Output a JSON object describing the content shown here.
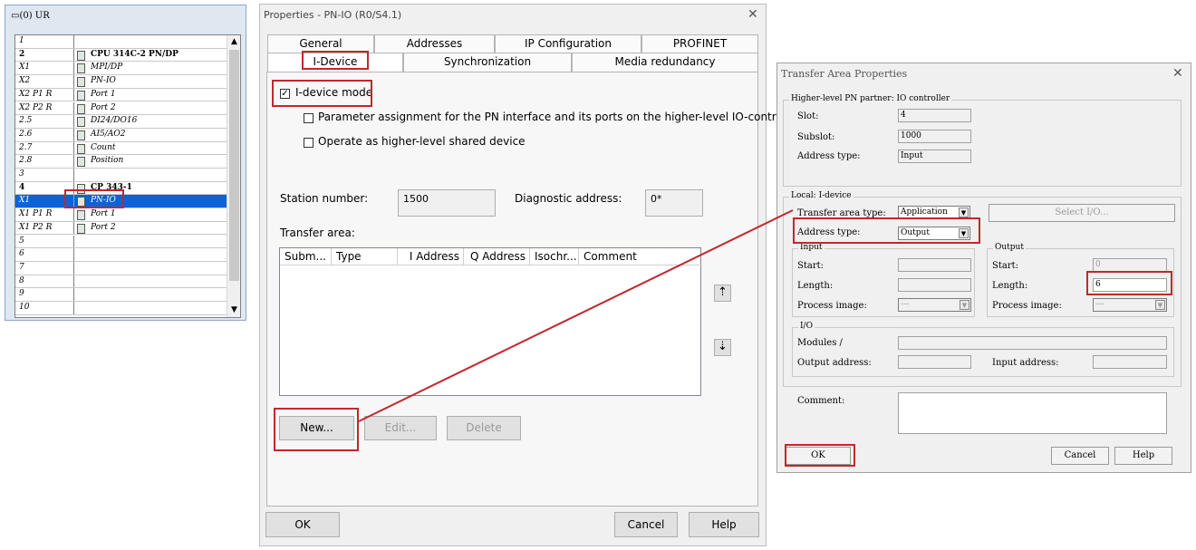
{
  "rack": {
    "title": "(0) UR",
    "rows": [
      {
        "slot": "1",
        "module": "",
        "bold": false,
        "icon": false
      },
      {
        "slot": "2",
        "module": "CPU 314C-2 PN/DP",
        "bold": true,
        "icon": true
      },
      {
        "slot": "X1",
        "module": "MPI/DP",
        "bold": false,
        "icon": true
      },
      {
        "slot": "X2",
        "module": "PN-IO",
        "bold": false,
        "icon": true
      },
      {
        "slot": "X2 P1 R",
        "module": "Port 1",
        "bold": false,
        "icon": true
      },
      {
        "slot": "X2 P2 R",
        "module": "Port 2",
        "bold": false,
        "icon": true
      },
      {
        "slot": "2.5",
        "module": "DI24/DO16",
        "bold": false,
        "icon": true
      },
      {
        "slot": "2.6",
        "module": "AI5/AO2",
        "bold": false,
        "icon": true
      },
      {
        "slot": "2.7",
        "module": "Count",
        "bold": false,
        "icon": true
      },
      {
        "slot": "2.8",
        "module": "Position",
        "bold": false,
        "icon": true
      },
      {
        "slot": "3",
        "module": "",
        "bold": false,
        "icon": false
      },
      {
        "slot": "4",
        "module": "CP 343-1",
        "bold": true,
        "icon": true
      },
      {
        "slot": "X1",
        "module": "PN-IO",
        "bold": false,
        "icon": true,
        "selected": true
      },
      {
        "slot": "X1 P1 R",
        "module": "Port 1",
        "bold": false,
        "icon": true
      },
      {
        "slot": "X1 P2 R",
        "module": "Port 2",
        "bold": false,
        "icon": true
      },
      {
        "slot": "5",
        "module": "",
        "bold": false,
        "icon": false
      },
      {
        "slot": "6",
        "module": "",
        "bold": false,
        "icon": false
      },
      {
        "slot": "7",
        "module": "",
        "bold": false,
        "icon": false
      },
      {
        "slot": "8",
        "module": "",
        "bold": false,
        "icon": false
      },
      {
        "slot": "9",
        "module": "",
        "bold": false,
        "icon": false
      },
      {
        "slot": "10",
        "module": "",
        "bold": false,
        "icon": false
      }
    ]
  },
  "properties": {
    "title": "Properties - PN-IO (R0/S4.1)",
    "tabs_row1": [
      "General",
      "Addresses",
      "IP Configuration",
      "PROFINET"
    ],
    "tabs_row2": [
      "I-Device",
      "Synchronization",
      "Media redundancy"
    ],
    "idevice_mode": "I-device mode",
    "param_assign": "Parameter assignment for the PN interface and its ports on the higher-level IO-controlle",
    "shared_device": "Operate as higher-level shared device",
    "station_number_label": "Station number:",
    "station_number": "1500",
    "diag_label": "Diagnostic address:",
    "diag_value": "0*",
    "transfer_area_label": "Transfer area:",
    "columns": [
      "Subm...",
      "Type",
      "I Address",
      "Q Address",
      "Isochr...",
      "Comment"
    ],
    "buttons": {
      "new": "New...",
      "edit": "Edit...",
      "delete": "Delete",
      "ok": "OK",
      "cancel": "Cancel",
      "help": "Help"
    }
  },
  "transfer_area": {
    "title": "Transfer Area Properties",
    "higher_group": "Higher-level  PN partner: IO controller",
    "slot_label": "Slot:",
    "slot": "4",
    "subslot_label": "Subslot:",
    "subslot": "1000",
    "addr_type_label": "Address type:",
    "addr_type": "Input",
    "local_group": "Local: I-device",
    "ta_type_label": "Transfer area type:",
    "ta_type": "Application",
    "select_io": "Select I/O...",
    "local_addr_type_label": "Address type:",
    "local_addr_type": "Output",
    "input_group": "Input",
    "output_group": "Output",
    "start_label": "Start:",
    "length_label": "Length:",
    "process_image_label": "Process image:",
    "process_image_value": "---",
    "out_start": "0",
    "out_length": "6",
    "io_group": "I/O",
    "modules_label": "Modules /",
    "output_address_label": "Output address:",
    "input_address_label": "Input address:",
    "comment_label": "Comment:",
    "buttons": {
      "ok": "OK",
      "cancel": "Cancel",
      "help": "Help"
    }
  },
  "colors": {
    "highlight_red": "#c0282d",
    "selection_blue": "#0a64d8"
  }
}
